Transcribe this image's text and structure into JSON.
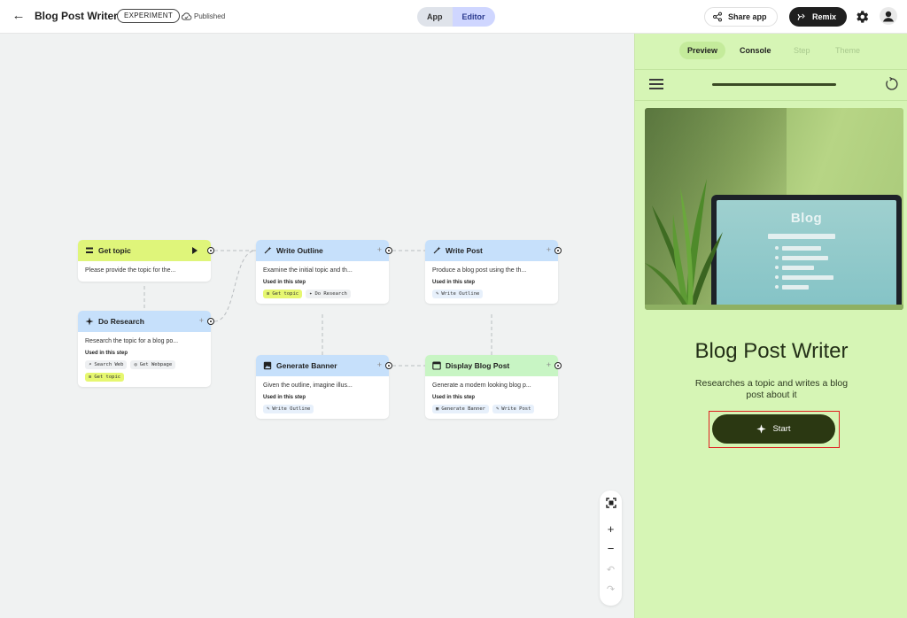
{
  "header": {
    "back_icon": "arrow-back-icon",
    "title": "Blog Post Writer",
    "badge": "EXPERIMENT",
    "status": "Published",
    "status_icon": "cloud-check-icon",
    "mode_tabs": [
      {
        "label": "App"
      },
      {
        "label": "Editor"
      }
    ],
    "active_mode": "Editor",
    "share_label": "Share app",
    "remix_label": "Remix"
  },
  "colors": {
    "canvas_bg": "#f0f2f2",
    "node_yellow": "#dff57a",
    "node_blue": "#c6e0fb",
    "node_green": "#c8f5c4",
    "panel_bg": "#d6f5b5",
    "start_button": "#2b3812",
    "highlight_frame": "#e02020"
  },
  "graph": {
    "used_label": "Used in this step",
    "nodes": [
      {
        "id": "get-topic",
        "title": "Get topic",
        "icon": "list-icon",
        "description": "Please provide the topic for the...",
        "chips": []
      },
      {
        "id": "do-research",
        "title": "Do Research",
        "icon": "sparkle-icon",
        "description": "Research the topic for a blog po...",
        "chips": [
          {
            "label": "Search Web",
            "icon": "search-icon"
          },
          {
            "label": "Get Webpage",
            "icon": "globe-icon"
          },
          {
            "label": "Get topic",
            "icon": "list-icon"
          }
        ]
      },
      {
        "id": "write-outline",
        "title": "Write Outline",
        "icon": "sparkle-pen-icon",
        "description": "Examine the initial topic and th...",
        "chips": [
          {
            "label": "Get topic",
            "icon": "list-icon"
          },
          {
            "label": "Do Research",
            "icon": "sparkle-icon"
          }
        ]
      },
      {
        "id": "write-post",
        "title": "Write Post",
        "icon": "sparkle-pen-icon",
        "description": "Produce a blog post using the th...",
        "chips": [
          {
            "label": "Write Outline",
            "icon": "sparkle-pen-icon"
          }
        ]
      },
      {
        "id": "generate-banner",
        "title": "Generate Banner",
        "icon": "image-icon",
        "description": "Given the outline, imagine illus...",
        "chips": [
          {
            "label": "Write Outline",
            "icon": "sparkle-pen-icon"
          }
        ]
      },
      {
        "id": "display-blog-post",
        "title": "Display Blog Post",
        "icon": "window-icon",
        "description": "Generate a modern looking blog p...",
        "chips": [
          {
            "label": "Generate Banner",
            "icon": "image-icon"
          },
          {
            "label": "Write Post",
            "icon": "sparkle-pen-icon"
          }
        ]
      }
    ]
  },
  "zoom_controls": [
    "fit-view-icon",
    "zoom-in-icon",
    "zoom-out-icon",
    "undo-icon",
    "redo-icon"
  ],
  "preview": {
    "tabs": [
      {
        "label": "Preview",
        "state": "active"
      },
      {
        "label": "Console",
        "state": "enabled"
      },
      {
        "label": "Step",
        "state": "disabled"
      },
      {
        "label": "Theme",
        "state": "disabled"
      }
    ],
    "hero_screen_text": "Blog",
    "title": "Blog Post Writer",
    "subtitle": "Researches a topic and writes a blog post about it",
    "start_label": "Start",
    "start_icon": "sparkle-icon"
  }
}
